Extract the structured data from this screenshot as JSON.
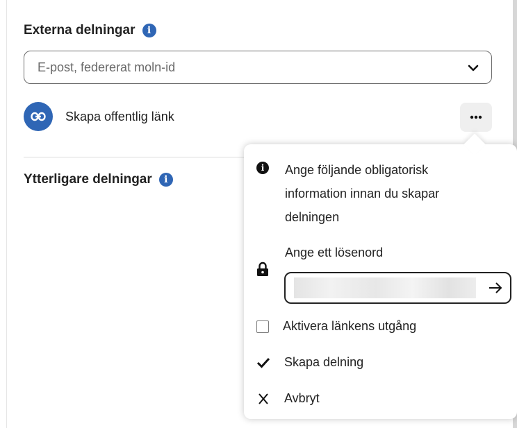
{
  "external": {
    "title": "Externa delningar",
    "search_placeholder": "E-post, federerat moln-id",
    "public_link_label": "Skapa offentlig länk"
  },
  "additional": {
    "title": "Ytterligare delningar"
  },
  "popover": {
    "info_line1": "Ange följande obligatorisk",
    "info_line2": "information innan du skapar",
    "info_line3": "delningen",
    "password_label": "Ange ett lösenord",
    "expiry_label": "Aktivera länkens utgång",
    "create_label": "Skapa delning",
    "cancel_label": "Avbryt"
  },
  "icons": {
    "info": "info-icon",
    "chevron": "chevron-down-icon",
    "link": "link-icon",
    "more": "more-horizontal-icon",
    "lock": "lock-icon",
    "submit": "arrow-right-icon",
    "check": "checkmark-icon",
    "close": "close-icon"
  },
  "colors": {
    "accent": "#2f66b5",
    "text": "#222222"
  }
}
